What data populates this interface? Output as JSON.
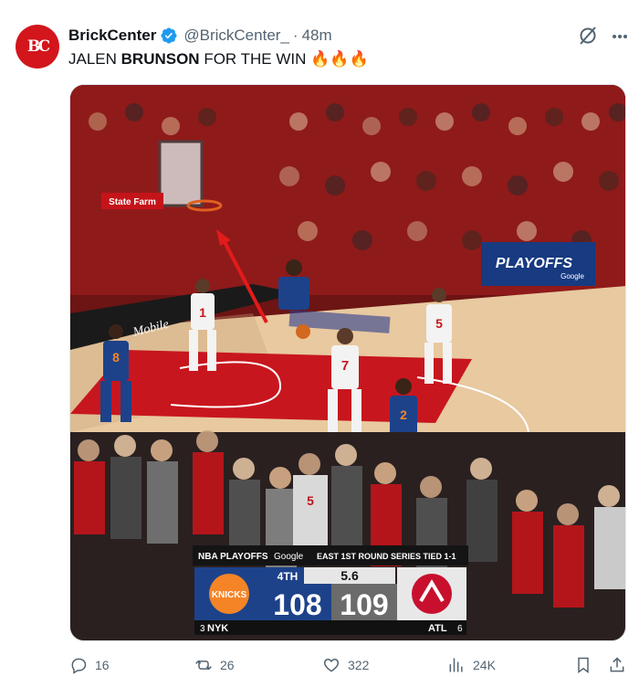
{
  "tweet": {
    "avatar_text": "BC",
    "display_name": "BrickCenter",
    "handle": "@BrickCenter_",
    "separator": "·",
    "timestamp": "48m",
    "text_before": "JALEN ",
    "text_bold": "BRUNSON",
    "text_after": " FOR THE WIN",
    "emoji": "🔥🔥🔥"
  },
  "media": {
    "icons": [
      "basketball-court-image"
    ],
    "scoreboard": {
      "playoffs_label": "NBA PLAYOFFS",
      "sponsor": "Google",
      "series_text": "EAST 1ST ROUND SERIES TIED 1-1",
      "period": "4TH",
      "clock": "5.6",
      "home": {
        "abbr": "NYK",
        "seed": "3",
        "score": "108",
        "logo_text": "KNICKS"
      },
      "away": {
        "abbr": "ATL",
        "seed": "6",
        "score": "109"
      }
    },
    "court_banner_1": "State Farm",
    "court_banner_2": "PLAYOFFS",
    "court_banner_sponsor": "Google",
    "floor_text": "Mobile",
    "jerseys": {
      "atl_1": "1",
      "atl_5": "5",
      "atl_7": "7",
      "nyk_8": "8",
      "nyk_2": "2",
      "fan_5": "5"
    }
  },
  "actions": {
    "replies": "16",
    "retweets": "26",
    "likes": "322",
    "views": "24K"
  },
  "colors": {
    "accent_blue": "#1d9bf0",
    "brand_red": "#d3151c",
    "muted": "#536471"
  }
}
